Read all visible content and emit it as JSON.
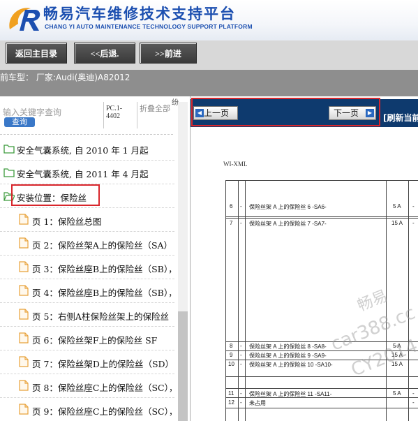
{
  "header": {
    "title": "畅易汽车维修技术支持平台",
    "subtitle": "CHANG YI AUTO MAINTENANCE TECHNOLOGY SUPPORT PLATFORM"
  },
  "nav": {
    "home": "返回主目录",
    "back": "<<后退.",
    "forward": ">>前进"
  },
  "vehicle": {
    "label": "前车型：  厂家:Audi(奥迪)A82012"
  },
  "search": {
    "placeholder": "输入关键字查询",
    "button": "查询",
    "pc_code": "PC.1-4402",
    "collapse": "折叠全部",
    "scroll_hint": "纷"
  },
  "tree": {
    "items": [
      {
        "type": "folder",
        "label": "安全气囊系统, 自 2010 年 1 月起"
      },
      {
        "type": "folder",
        "label": "安全气囊系统, 自 2011 年 4 月起"
      },
      {
        "type": "folder",
        "label": "安装位置：保险丝"
      },
      {
        "type": "page",
        "label": "页 1：保险丝总图"
      },
      {
        "type": "page",
        "label": "页 2：保险丝架A上的保险丝（SA）"
      },
      {
        "type": "page",
        "label": "页 3：保险丝座B上的保险丝（SB），"
      },
      {
        "type": "page",
        "label": "页 4：保险丝座B上的保险丝（SB），"
      },
      {
        "type": "page",
        "label": "页 5：右侧A柱保险丝架上的保险丝"
      },
      {
        "type": "page",
        "label": "页 6：保险丝架F上的保险丝 SF"
      },
      {
        "type": "page",
        "label": "页 7：保险丝架D上的保险丝（SD）"
      },
      {
        "type": "page",
        "label": "页 8：保险丝座C上的保险丝（SC），"
      },
      {
        "type": "page",
        "label": "页 9：保险丝座C上的保险丝（SC），"
      }
    ]
  },
  "viewer": {
    "prev": "上一页",
    "next": "下一页",
    "refresh": "[刷新当前"
  },
  "document": {
    "id": "WI-XML",
    "rows": [
      {
        "no": "6",
        "dash": "-",
        "desc": "保险丝架 A 上的保险丝 6 -SA6-",
        "amp": "5 A",
        "tail": "-"
      },
      {
        "no": "7",
        "dash": "-",
        "desc": "保险丝架 A 上的保险丝 7 -SA7-",
        "amp": "15 A",
        "tail": "-"
      },
      {
        "no": "8",
        "dash": "-",
        "desc": "保险丝架 A 上的保险丝 8 -SA8-",
        "amp": "5 A",
        "tail": ""
      },
      {
        "no": "9",
        "dash": "-",
        "desc": "保险丝架 A 上的保险丝 9 -SA9-",
        "amp": "15 A",
        "tail": ""
      },
      {
        "no": "10",
        "dash": "-",
        "desc": "保险丝架 A 上的保险丝 10 -SA10-",
        "amp": "15 A",
        "tail": ""
      },
      {
        "no": "11",
        "dash": "-",
        "desc": "保险丝架 A 上的保险丝 11 -SA11-",
        "amp": "5 A",
        "tail": "-"
      },
      {
        "no": "12",
        "dash": "-",
        "desc": "未占用",
        "amp": "",
        "tail": "-"
      }
    ]
  },
  "watermark": {
    "line1": "畅易",
    "line2": "car388.cc",
    "line3": "CY2014"
  },
  "colors": {
    "brand_blue": "#1c4fb0",
    "viewer_bar": "#0e3a6e",
    "highlight_red": "#d8262c",
    "folder_green": "#3c9a3c",
    "page_orange": "#e8a23a"
  }
}
